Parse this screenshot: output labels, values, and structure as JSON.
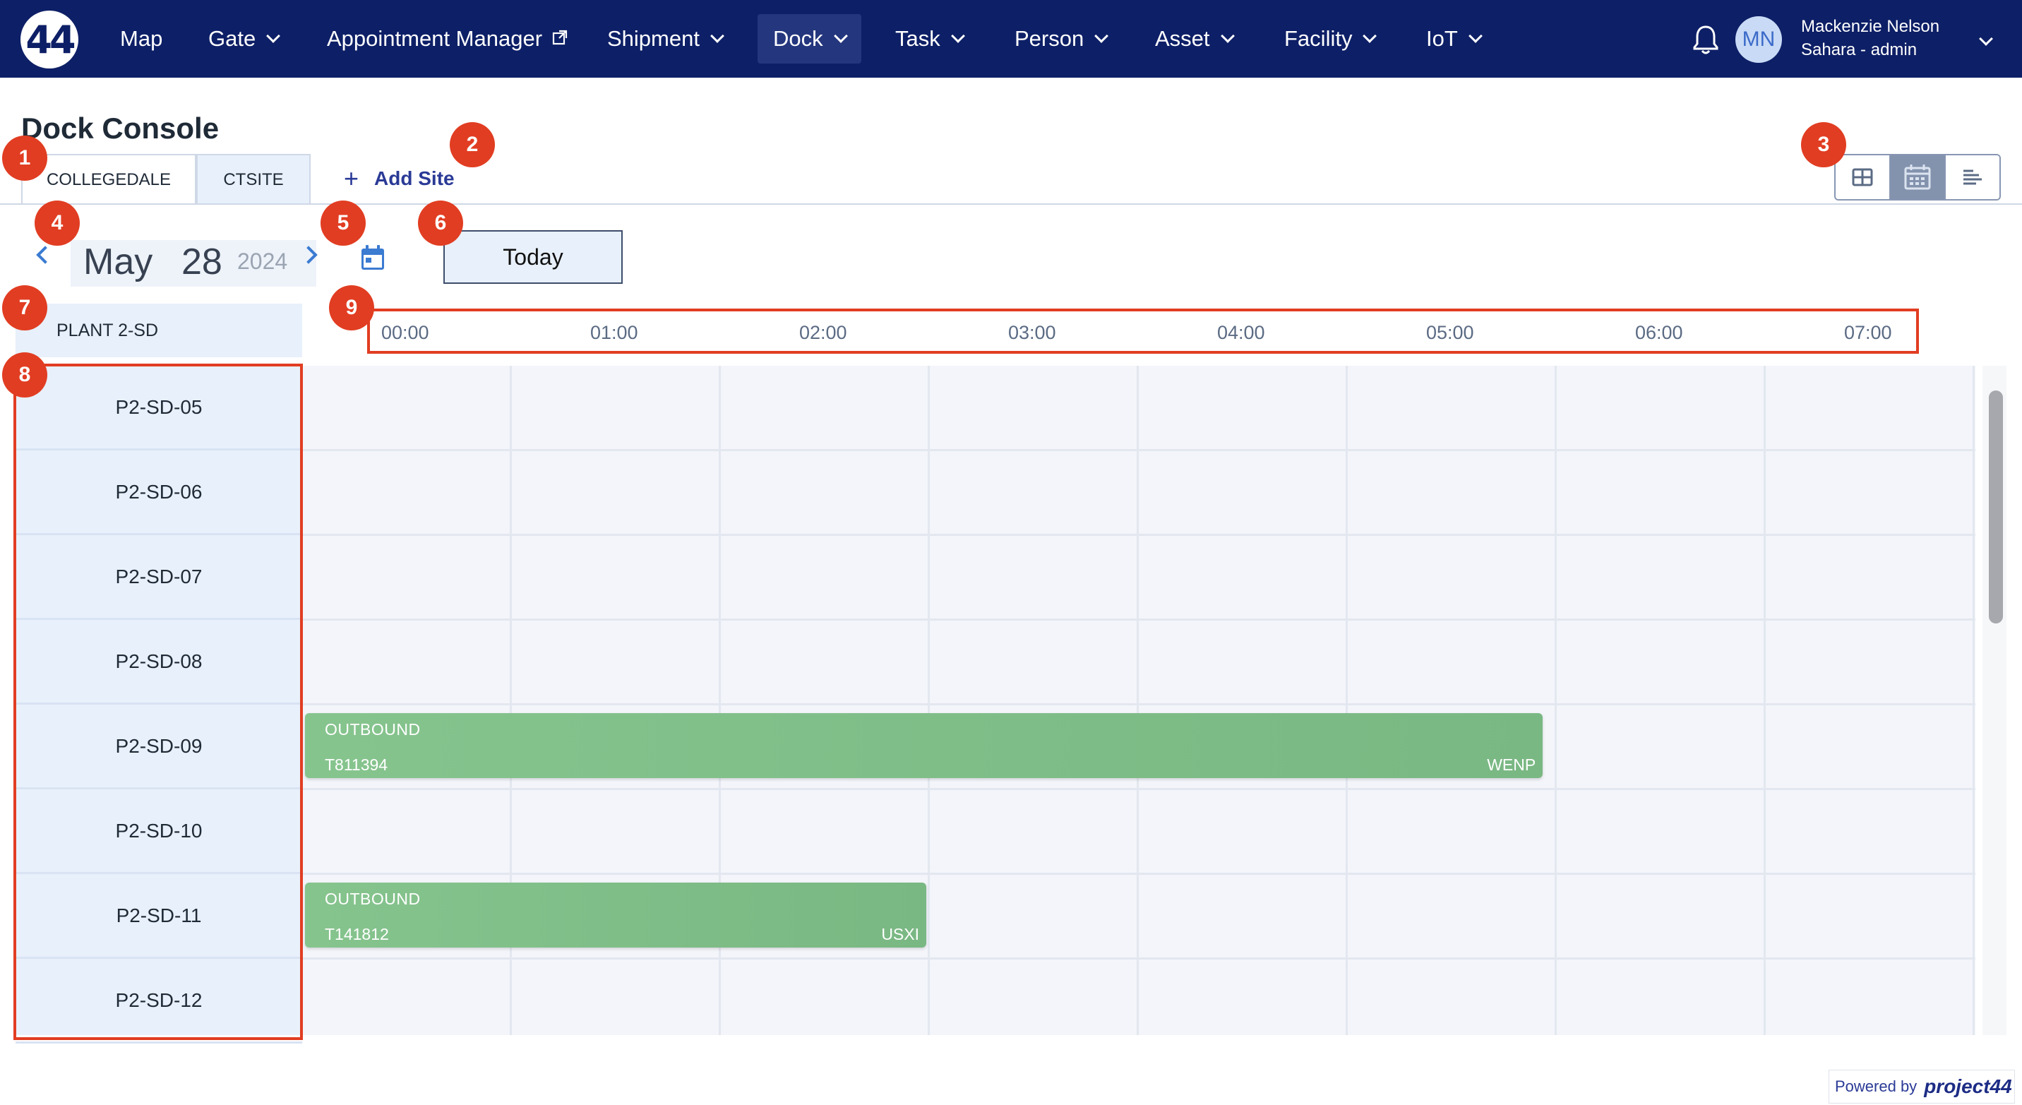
{
  "nav": {
    "logo_text": "44",
    "items": [
      {
        "label": "Map",
        "dropdown": false
      },
      {
        "label": "Gate",
        "dropdown": true
      },
      {
        "label": "Appointment Manager",
        "external": true
      },
      {
        "label": "Shipment",
        "dropdown": true
      },
      {
        "label": "Dock",
        "dropdown": true,
        "active": true
      },
      {
        "label": "Task",
        "dropdown": true
      },
      {
        "label": "Person",
        "dropdown": true
      },
      {
        "label": "Asset",
        "dropdown": true
      },
      {
        "label": "Facility",
        "dropdown": true
      },
      {
        "label": "IoT",
        "dropdown": true
      }
    ],
    "avatar_initials": "MN",
    "user_name": "Mackenzie Nelson",
    "user_role": "Sahara - admin"
  },
  "page": {
    "title": "Dock Console",
    "tabs": [
      {
        "label": "COLLEGEDALE",
        "active": true
      },
      {
        "label": "CTSITE",
        "active": false
      }
    ],
    "add_site_label": "Add Site",
    "add_site_icon": "+",
    "view_modes": [
      "grid-view-icon",
      "calendar-view-icon",
      "list-view-icon"
    ],
    "active_view": "calendar-view-icon"
  },
  "date": {
    "month": "May",
    "day": "28",
    "year": "2024",
    "today_label": "Today"
  },
  "schedule": {
    "group_label": "PLANT 2-SD",
    "time_labels": [
      "00:00",
      "01:00",
      "02:00",
      "03:00",
      "04:00",
      "05:00",
      "06:00",
      "07:00"
    ],
    "docks": [
      "P2-SD-05",
      "P2-SD-06",
      "P2-SD-07",
      "P2-SD-08",
      "P2-SD-09",
      "P2-SD-10",
      "P2-SD-11",
      "P2-SD-12"
    ],
    "appointments": [
      {
        "dock": "P2-SD-09",
        "direction": "OUTBOUND",
        "ref": "T811394",
        "carrier": "WENP",
        "start_hour": 0,
        "end_hour": 5.95
      },
      {
        "dock": "P2-SD-11",
        "direction": "OUTBOUND",
        "ref": "T141812",
        "carrier": "USXI",
        "start_hour": 0,
        "end_hour": 3.0
      }
    ],
    "appointment_color": "#7ab883"
  },
  "footer": {
    "powered_by": "Powered by",
    "brand": "project44"
  },
  "annotations": [
    "1",
    "2",
    "3",
    "4",
    "5",
    "6",
    "7",
    "8",
    "9"
  ],
  "colors": {
    "nav_bg": "#0d1f66",
    "accent": "#2a3a96",
    "marker": "#e13d22",
    "row_bg": "#e8f0fb"
  }
}
